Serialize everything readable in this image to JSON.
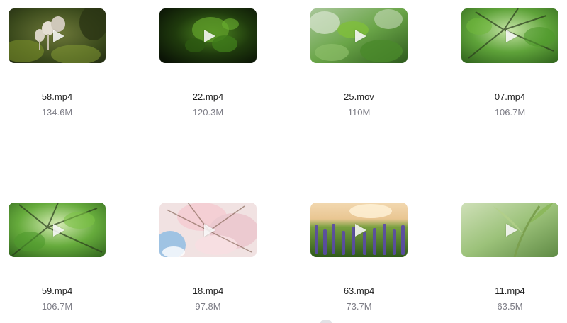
{
  "colors": {
    "filename": "#1f1f1f",
    "filesize": "#7d7d86"
  },
  "videos": [
    {
      "name": "58.mp4",
      "size": "134.6M"
    },
    {
      "name": "22.mp4",
      "size": "120.3M"
    },
    {
      "name": "25.mov",
      "size": "110M"
    },
    {
      "name": "07.mp4",
      "size": "106.7M"
    },
    {
      "name": "59.mp4",
      "size": "106.7M"
    },
    {
      "name": "18.mp4",
      "size": "97.8M"
    },
    {
      "name": "63.mp4",
      "size": "73.7M"
    },
    {
      "name": "11.mp4",
      "size": "63.5M"
    }
  ]
}
